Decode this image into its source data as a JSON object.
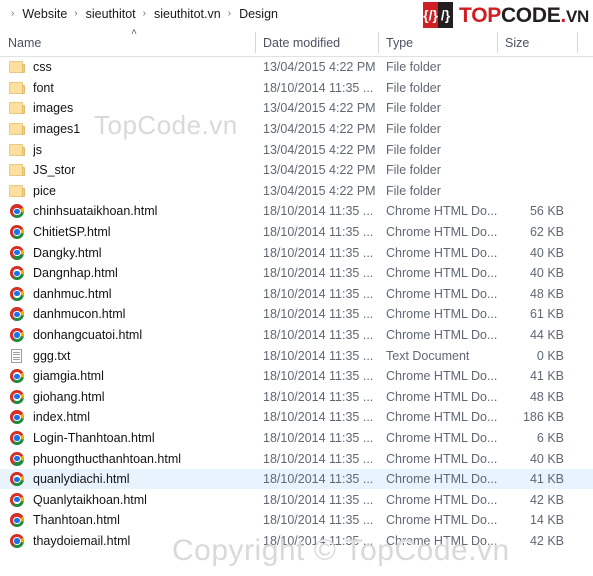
{
  "breadcrumb": {
    "separator": "›",
    "items": [
      "Website",
      "sieuthitot",
      "sieuthitot.vn",
      "Design"
    ]
  },
  "logo": {
    "mark_left": "{/}",
    "mark_right": "/}",
    "text_top": "TOP",
    "text_code": "CODE",
    "text_dot": ".",
    "text_vn": "VN"
  },
  "columns": {
    "name": "Name",
    "date_modified": "Date modified",
    "type": "Type",
    "size": "Size",
    "sort_caret": "˄"
  },
  "watermarks": {
    "top": "TopCode.vn",
    "bottom": "Copyright © TopCode.vn"
  },
  "rows": [
    {
      "icon": "folder-icon",
      "name": "css",
      "date": "13/04/2015 4:22 PM",
      "type": "File folder",
      "size": "",
      "selected": false
    },
    {
      "icon": "folder-icon",
      "name": "font",
      "date": "18/10/2014 11:35 ...",
      "type": "File folder",
      "size": "",
      "selected": false
    },
    {
      "icon": "folder-icon",
      "name": "images",
      "date": "13/04/2015 4:22 PM",
      "type": "File folder",
      "size": "",
      "selected": false
    },
    {
      "icon": "folder-icon",
      "name": "images1",
      "date": "13/04/2015 4:22 PM",
      "type": "File folder",
      "size": "",
      "selected": false
    },
    {
      "icon": "folder-icon",
      "name": "js",
      "date": "13/04/2015 4:22 PM",
      "type": "File folder",
      "size": "",
      "selected": false
    },
    {
      "icon": "folder-icon",
      "name": "JS_stor",
      "date": "13/04/2015 4:22 PM",
      "type": "File folder",
      "size": "",
      "selected": false
    },
    {
      "icon": "folder-icon",
      "name": "pice",
      "date": "13/04/2015 4:22 PM",
      "type": "File folder",
      "size": "",
      "selected": false
    },
    {
      "icon": "chrome-icon",
      "name": "chinhsuataikhoan.html",
      "date": "18/10/2014 11:35 ...",
      "type": "Chrome HTML Do...",
      "size": "56 KB",
      "selected": false
    },
    {
      "icon": "chrome-icon",
      "name": "ChitietSP.html",
      "date": "18/10/2014 11:35 ...",
      "type": "Chrome HTML Do...",
      "size": "62 KB",
      "selected": false
    },
    {
      "icon": "chrome-icon",
      "name": "Dangky.html",
      "date": "18/10/2014 11:35 ...",
      "type": "Chrome HTML Do...",
      "size": "40 KB",
      "selected": false
    },
    {
      "icon": "chrome-icon",
      "name": "Dangnhap.html",
      "date": "18/10/2014 11:35 ...",
      "type": "Chrome HTML Do...",
      "size": "40 KB",
      "selected": false
    },
    {
      "icon": "chrome-icon",
      "name": "danhmuc.html",
      "date": "18/10/2014 11:35 ...",
      "type": "Chrome HTML Do...",
      "size": "48 KB",
      "selected": false
    },
    {
      "icon": "chrome-icon",
      "name": "danhmucon.html",
      "date": "18/10/2014 11:35 ...",
      "type": "Chrome HTML Do...",
      "size": "61 KB",
      "selected": false
    },
    {
      "icon": "chrome-icon",
      "name": "donhangcuatoi.html",
      "date": "18/10/2014 11:35 ...",
      "type": "Chrome HTML Do...",
      "size": "44 KB",
      "selected": false
    },
    {
      "icon": "text-icon",
      "name": "ggg.txt",
      "date": "18/10/2014 11:35 ...",
      "type": "Text Document",
      "size": "0 KB",
      "selected": false
    },
    {
      "icon": "chrome-icon",
      "name": "giamgia.html",
      "date": "18/10/2014 11:35 ...",
      "type": "Chrome HTML Do...",
      "size": "41 KB",
      "selected": false
    },
    {
      "icon": "chrome-icon",
      "name": "giohang.html",
      "date": "18/10/2014 11:35 ...",
      "type": "Chrome HTML Do...",
      "size": "48 KB",
      "selected": false
    },
    {
      "icon": "chrome-icon",
      "name": "index.html",
      "date": "18/10/2014 11:35 ...",
      "type": "Chrome HTML Do...",
      "size": "186 KB",
      "selected": false
    },
    {
      "icon": "chrome-icon",
      "name": "Login-Thanhtoan.html",
      "date": "18/10/2014 11:35 ...",
      "type": "Chrome HTML Do...",
      "size": "6 KB",
      "selected": false
    },
    {
      "icon": "chrome-icon",
      "name": "phuongthucthanhtoan.html",
      "date": "18/10/2014 11:35 ...",
      "type": "Chrome HTML Do...",
      "size": "40 KB",
      "selected": false
    },
    {
      "icon": "chrome-icon",
      "name": "quanlydiachi.html",
      "date": "18/10/2014 11:35 ...",
      "type": "Chrome HTML Do...",
      "size": "41 KB",
      "selected": true
    },
    {
      "icon": "chrome-icon",
      "name": "Quanlytaikhoan.html",
      "date": "18/10/2014 11:35 ...",
      "type": "Chrome HTML Do...",
      "size": "42 KB",
      "selected": false
    },
    {
      "icon": "chrome-icon",
      "name": "Thanhtoan.html",
      "date": "18/10/2014 11:35 ...",
      "type": "Chrome HTML Do...",
      "size": "14 KB",
      "selected": false
    },
    {
      "icon": "chrome-icon",
      "name": "thaydoiemail.html",
      "date": "18/10/2014 11:35 ...",
      "type": "Chrome HTML Do...",
      "size": "42 KB",
      "selected": false
    }
  ]
}
